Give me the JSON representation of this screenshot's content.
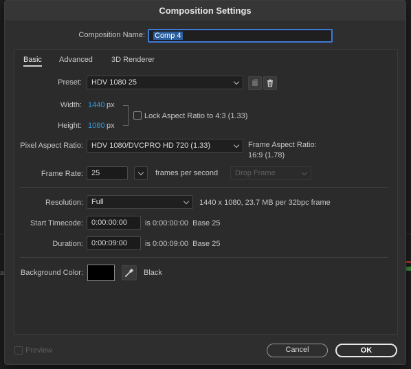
{
  "dialog": {
    "title": "Composition Settings"
  },
  "comp_name": {
    "label": "Composition Name:",
    "value": "Comp 4"
  },
  "tabs": [
    {
      "label": "Basic",
      "active": true
    },
    {
      "label": "Advanced",
      "active": false
    },
    {
      "label": "3D Renderer",
      "active": false
    }
  ],
  "preset": {
    "label": "Preset:",
    "value": "HDV 1080 25"
  },
  "width": {
    "label": "Width:",
    "value": "1440",
    "unit": "px"
  },
  "height": {
    "label": "Height:",
    "value": "1080",
    "unit": "px"
  },
  "lock_aspect": {
    "label": "Lock Aspect Ratio to 4:3 (1.33)",
    "checked": false
  },
  "pixel_aspect": {
    "label": "Pixel Aspect Ratio:",
    "value": "HDV 1080/DVCPRO HD 720 (1.33)",
    "frame_aspect_label": "Frame Aspect Ratio:",
    "frame_aspect_value": "16:9 (1.78)"
  },
  "frame_rate": {
    "label": "Frame Rate:",
    "value": "25",
    "unit_label": "frames per second",
    "drop_frame": "Drop Frame"
  },
  "resolution": {
    "label": "Resolution:",
    "value": "Full",
    "info": "1440 x 1080, 23.7 MB per 32bpc frame"
  },
  "start_timecode": {
    "label": "Start Timecode:",
    "value": "0:00:00:00",
    "info": "is 0:00:00:00  Base 25"
  },
  "duration": {
    "label": "Duration:",
    "value": "0:00:09:00",
    "info": "is 0:00:09:00  Base 25"
  },
  "background_color": {
    "label": "Background Color:",
    "color_hex": "#000000",
    "name": "Black"
  },
  "footer": {
    "preview_label": "Preview",
    "cancel_label": "Cancel",
    "ok_label": "OK"
  },
  "colors": {
    "accent_blue": "#2d9fe3",
    "focus_ring": "#3d7bd8"
  }
}
